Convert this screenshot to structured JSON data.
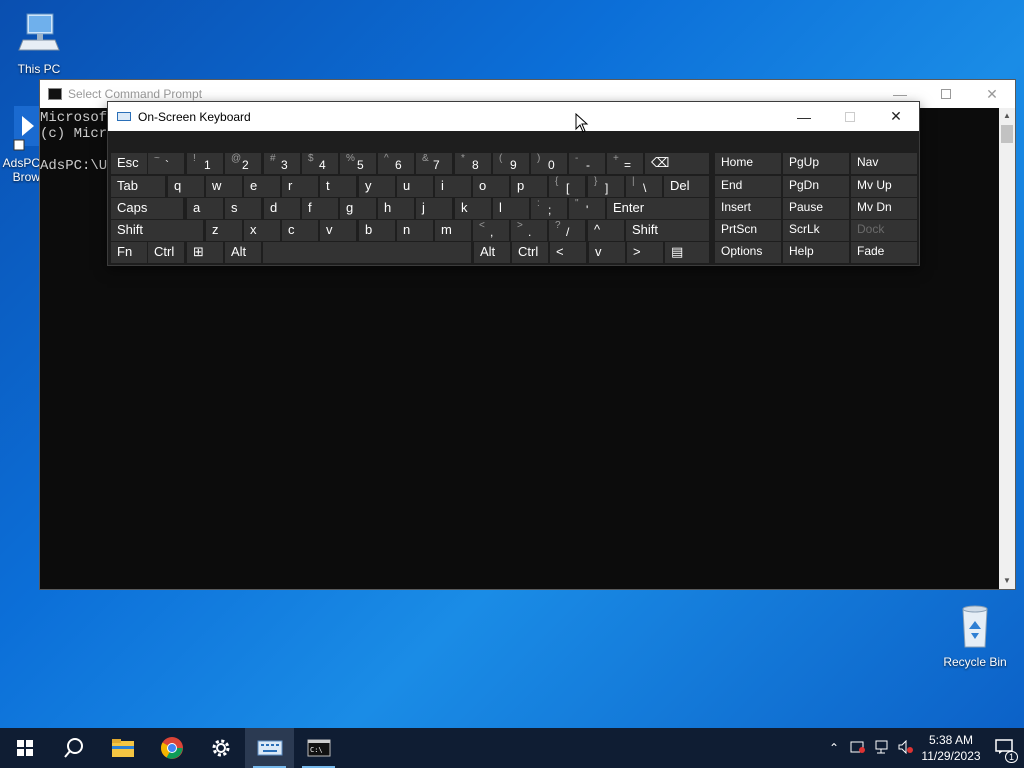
{
  "desktop": {
    "icons": [
      {
        "label": "This PC",
        "icon": "computer-icon"
      },
      {
        "label": "AdsPC",
        "label2": "Brow",
        "icon": "app-icon"
      },
      {
        "label": "Recycle Bin",
        "icon": "recycle-bin-icon"
      }
    ]
  },
  "cmd": {
    "title": "Select Command Prompt",
    "lines": [
      "Microsoft",
      "(c) Micro",
      "",
      "AdsPC:\\Users\\"
    ]
  },
  "osk": {
    "title": "On-Screen Keyboard",
    "rows": [
      [
        {
          "main": "Esc"
        },
        {
          "shift": "~",
          "main": "`"
        },
        {
          "shift": "!",
          "main": "1"
        },
        {
          "shift": "@",
          "main": "2"
        },
        {
          "shift": "#",
          "main": "3"
        },
        {
          "shift": "$",
          "main": "4"
        },
        {
          "shift": "%",
          "main": "5"
        },
        {
          "shift": "^",
          "main": "6"
        },
        {
          "shift": "&",
          "main": "7"
        },
        {
          "shift": "*",
          "main": "8"
        },
        {
          "shift": "(",
          "main": "9"
        },
        {
          "shift": ")",
          "main": "0"
        },
        {
          "shift": "-",
          "main": "-"
        },
        {
          "shift": "+",
          "main": "="
        },
        {
          "main": "⌫"
        }
      ],
      [
        {
          "main": "Tab"
        },
        {
          "main": "q"
        },
        {
          "main": "w"
        },
        {
          "main": "e"
        },
        {
          "main": "r"
        },
        {
          "main": "t"
        },
        {
          "main": "y"
        },
        {
          "main": "u"
        },
        {
          "main": "i"
        },
        {
          "main": "o"
        },
        {
          "main": "p"
        },
        {
          "shift": "{",
          "main": "["
        },
        {
          "shift": "}",
          "main": "]"
        },
        {
          "shift": "|",
          "main": "\\"
        },
        {
          "main": "Del"
        }
      ],
      [
        {
          "main": "Caps"
        },
        {
          "main": "a"
        },
        {
          "main": "s"
        },
        {
          "main": "d"
        },
        {
          "main": "f"
        },
        {
          "main": "g"
        },
        {
          "main": "h"
        },
        {
          "main": "j"
        },
        {
          "main": "k"
        },
        {
          "main": "l"
        },
        {
          "shift": ":",
          "main": ";"
        },
        {
          "shift": "\"",
          "main": "'"
        },
        {
          "main": "Enter"
        }
      ],
      [
        {
          "main": "Shift"
        },
        {
          "main": "z"
        },
        {
          "main": "x"
        },
        {
          "main": "c"
        },
        {
          "main": "v"
        },
        {
          "main": "b"
        },
        {
          "main": "n"
        },
        {
          "main": "m"
        },
        {
          "shift": "<",
          "main": ","
        },
        {
          "shift": ">",
          "main": "."
        },
        {
          "shift": "?",
          "main": "/"
        },
        {
          "main": "^"
        },
        {
          "main": "Shift"
        }
      ],
      [
        {
          "main": "Fn"
        },
        {
          "main": "Ctrl"
        },
        {
          "main": "⊞"
        },
        {
          "main": "Alt"
        },
        {
          "main": ""
        },
        {
          "main": "Alt"
        },
        {
          "main": "Ctrl"
        },
        {
          "main": "<"
        },
        {
          "main": "v"
        },
        {
          "main": ">"
        },
        {
          "main": "▤"
        }
      ]
    ],
    "nav": [
      [
        "Home",
        "PgUp",
        "Nav"
      ],
      [
        "End",
        "PgDn",
        "Mv Up"
      ],
      [
        "Insert",
        "Pause",
        "Mv Dn"
      ],
      [
        "PrtScn",
        "ScrLk",
        "Dock"
      ],
      [
        "Options",
        "Help",
        "Fade"
      ]
    ]
  },
  "taskbar": {
    "apps": [
      "start-icon",
      "search-icon",
      "file-explorer-icon",
      "chrome-icon",
      "settings-icon",
      "on-screen-keyboard-icon",
      "command-prompt-icon"
    ],
    "time": "5:38 AM",
    "date": "11/29/2023",
    "notification_count": "1"
  }
}
